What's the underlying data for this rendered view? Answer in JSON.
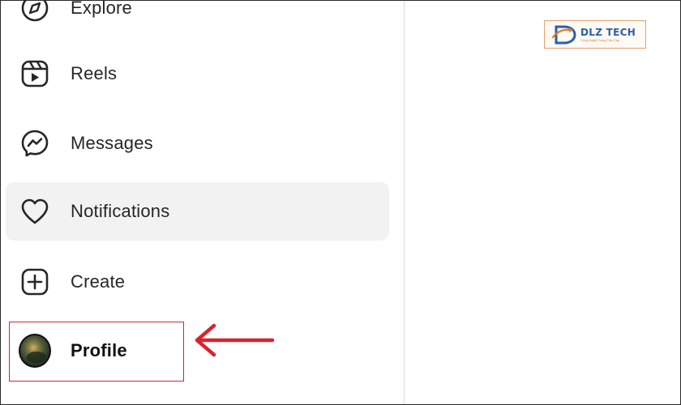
{
  "sidebar": {
    "items": [
      {
        "label": "Explore",
        "icon": "compass-icon"
      },
      {
        "label": "Reels",
        "icon": "reels-icon"
      },
      {
        "label": "Messages",
        "icon": "messenger-icon"
      },
      {
        "label": "Notifications",
        "icon": "heart-icon",
        "active": true
      },
      {
        "label": "Create",
        "icon": "plus-square-icon"
      },
      {
        "label": "Profile",
        "icon": "avatar",
        "bold": true
      }
    ]
  },
  "annotation": {
    "highlight_color": "#d9232e",
    "arrow_color": "#d9232e",
    "arrow_icon": "arrow-left-icon"
  },
  "watermark": {
    "title": "DLZ TECH",
    "subtitle": "Công Nghệ Trong Tầm Tay"
  },
  "colors": {
    "active_bg": "#f2f2f2",
    "divider": "#dbdbdb",
    "text": "#262626"
  }
}
